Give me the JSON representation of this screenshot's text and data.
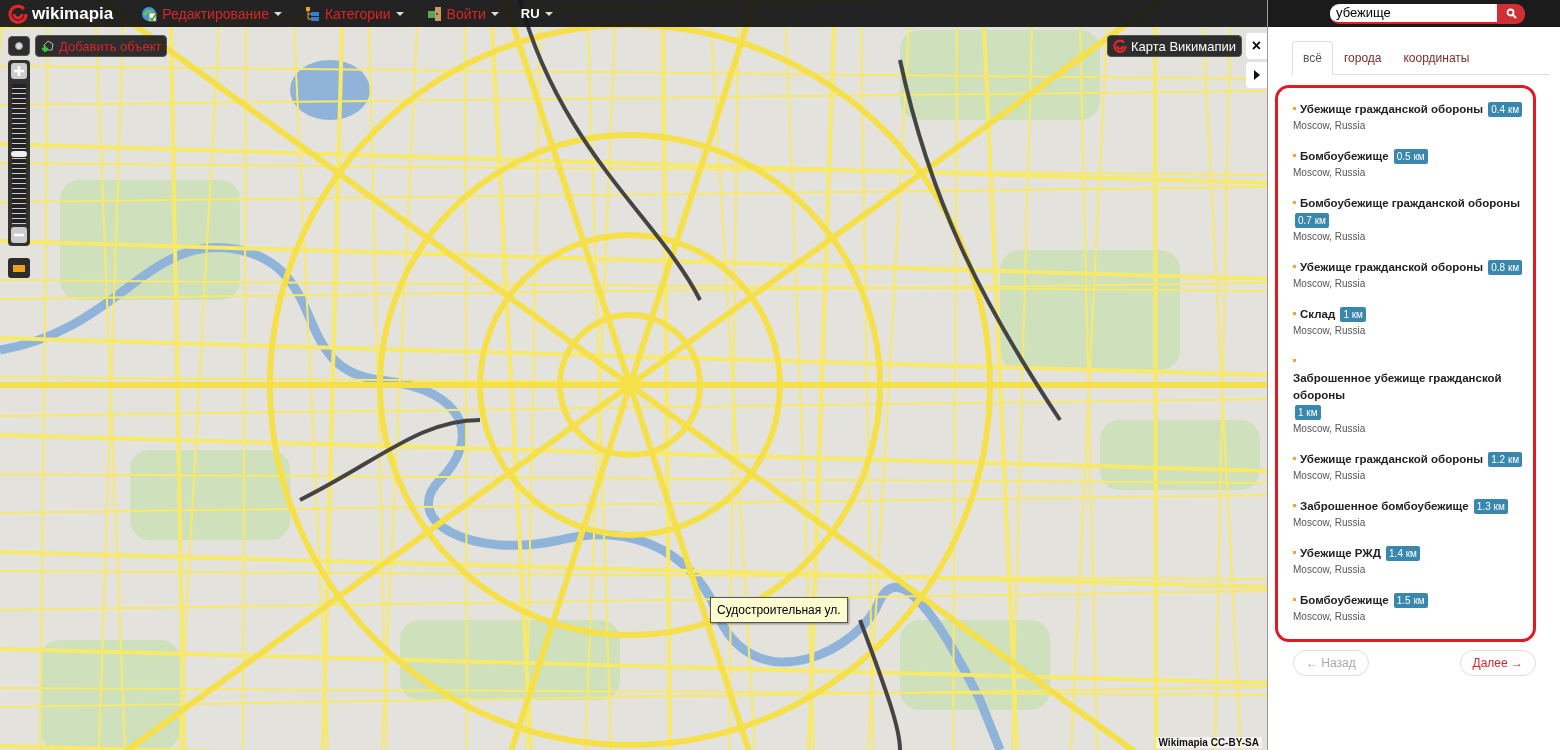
{
  "topbar": {
    "logo": "wikimapia",
    "menus": [
      {
        "label": "Редактирование",
        "kind": "edit"
      },
      {
        "label": "Категории",
        "kind": "categories"
      },
      {
        "label": "Войти",
        "kind": "login"
      },
      {
        "label": "RU",
        "kind": "language"
      }
    ]
  },
  "map": {
    "add_object": "Добавить объект",
    "layer_button": "Карта Викимапии",
    "close": "×",
    "zoom": {
      "level": 0.5
    },
    "tooltip": "Судостроительная ул.",
    "attribution": "Wikimapia CC-BY-SA"
  },
  "search": {
    "value": "убежище"
  },
  "tabs": [
    {
      "label": "всё",
      "selected": true
    },
    {
      "label": "города",
      "selected": false
    },
    {
      "label": "координаты",
      "selected": false
    }
  ],
  "results": [
    {
      "title": "Убежище гражданской обороны",
      "distance": "0.4 км",
      "location": "Moscow, Russia"
    },
    {
      "title": "Бомбоубежище",
      "distance": "0.5 км",
      "location": "Moscow, Russia"
    },
    {
      "title": "Бомбоубежище гражданской обороны",
      "distance": "0.7 км",
      "location": "Moscow, Russia"
    },
    {
      "title": "Убежище гражданской обороны",
      "distance": "0.8 км",
      "location": "Moscow, Russia"
    },
    {
      "title": "Склад",
      "distance": "1 км",
      "location": "Moscow, Russia"
    },
    {
      "title": "Заброшенное убежище гражданской обороны",
      "distance": "1 км",
      "location": "Moscow, Russia"
    },
    {
      "title": "Убежище гражданской обороны",
      "distance": "1.2 км",
      "location": "Moscow, Russia"
    },
    {
      "title": "Заброшенное бомбоубежище",
      "distance": "1.3 км",
      "location": "Moscow, Russia"
    },
    {
      "title": "Убежище РЖД",
      "distance": "1.4 км",
      "location": "Moscow, Russia"
    },
    {
      "title": "Бомбоубежище",
      "distance": "1.5 км",
      "location": "Moscow, Russia"
    }
  ],
  "pager": [
    {
      "label": "← Назад",
      "disabled": true
    },
    {
      "label": "Далее →",
      "disabled": false
    }
  ]
}
